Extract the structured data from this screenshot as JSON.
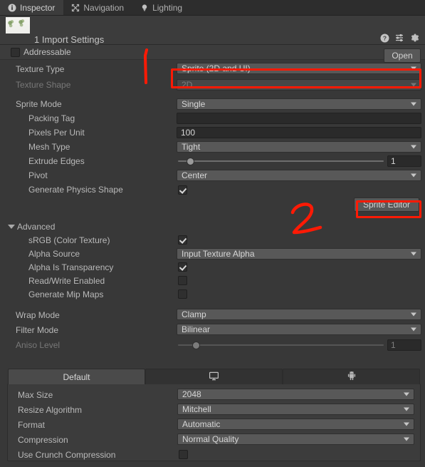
{
  "window": {
    "tabs": [
      {
        "label": "Inspector",
        "icon": "info-icon",
        "active": true
      },
      {
        "label": "Navigation",
        "icon": "navigation-icon",
        "active": false
      },
      {
        "label": "Lighting",
        "icon": "lighting-bulb-icon",
        "active": false
      }
    ]
  },
  "header": {
    "title": "1 Import Settings",
    "help_icon": "help-icon",
    "preset_icon": "preset-sliders-icon",
    "settings_icon": "gear-icon",
    "open_label": "Open"
  },
  "addressable": {
    "label": "Addressable",
    "checked": false
  },
  "main_rows": [
    {
      "label": "Texture Type",
      "type": "popup",
      "value": "Sprite (2D and UI)",
      "disabled": false,
      "highlight": true
    },
    {
      "label": "Texture Shape",
      "type": "popup",
      "value": "2D",
      "disabled": true,
      "highlight": false
    },
    {
      "label": "",
      "type": "spacer"
    },
    {
      "label": "Sprite Mode",
      "type": "popup",
      "value": "Single",
      "disabled": false
    },
    {
      "label": "Packing Tag",
      "type": "text",
      "value": "",
      "indent": true
    },
    {
      "label": "Pixels Per Unit",
      "type": "text",
      "value": "100",
      "indent": true
    },
    {
      "label": "Mesh Type",
      "type": "popup",
      "value": "Tight",
      "indent": true
    },
    {
      "label": "Extrude Edges",
      "type": "slider",
      "value": "1",
      "fraction": 0.04,
      "indent": true
    },
    {
      "label": "Pivot",
      "type": "popup",
      "value": "Center",
      "indent": true
    },
    {
      "label": "Generate Physics Shape",
      "type": "checkbox",
      "checked": true,
      "indent": true
    }
  ],
  "sprite_editor": {
    "label": "Sprite Editor"
  },
  "advanced": {
    "label": "Advanced",
    "expanded": true,
    "rows": [
      {
        "label": "sRGB (Color Texture)",
        "type": "checkbox",
        "checked": true
      },
      {
        "label": "Alpha Source",
        "type": "popup",
        "value": "Input Texture Alpha"
      },
      {
        "label": "Alpha Is Transparency",
        "type": "checkbox",
        "checked": true
      },
      {
        "label": "Read/Write Enabled",
        "type": "checkbox",
        "checked": false
      },
      {
        "label": "Generate Mip Maps",
        "type": "checkbox",
        "checked": false
      }
    ]
  },
  "texture_rows": [
    {
      "label": "Wrap Mode",
      "type": "popup",
      "value": "Clamp",
      "disabled": false
    },
    {
      "label": "Filter Mode",
      "type": "popup",
      "value": "Bilinear",
      "disabled": false
    },
    {
      "label": "Aniso Level",
      "type": "slider",
      "value": "1",
      "fraction": 0.07,
      "disabled": true
    }
  ],
  "platform": {
    "tabs": [
      {
        "label": "Default",
        "icon": "",
        "active": true
      },
      {
        "label": "",
        "icon": "desktop-monitor-icon",
        "active": false
      },
      {
        "label": "",
        "icon": "android-robot-icon",
        "active": false
      }
    ],
    "rows": [
      {
        "label": "Max Size",
        "type": "popup",
        "value": "2048"
      },
      {
        "label": "Resize Algorithm",
        "type": "popup",
        "value": "Mitchell"
      },
      {
        "label": "Format",
        "type": "popup",
        "value": "Automatic"
      },
      {
        "label": "Compression",
        "type": "popup",
        "value": "Normal Quality"
      },
      {
        "label": "Use Crunch Compression",
        "type": "checkbox",
        "checked": false
      }
    ]
  },
  "annotations": {
    "color": "#ff1a05",
    "marks": [
      {
        "name": "annotation-stroke-1",
        "text": "1"
      },
      {
        "name": "annotation-stroke-2",
        "text": "2"
      }
    ]
  }
}
